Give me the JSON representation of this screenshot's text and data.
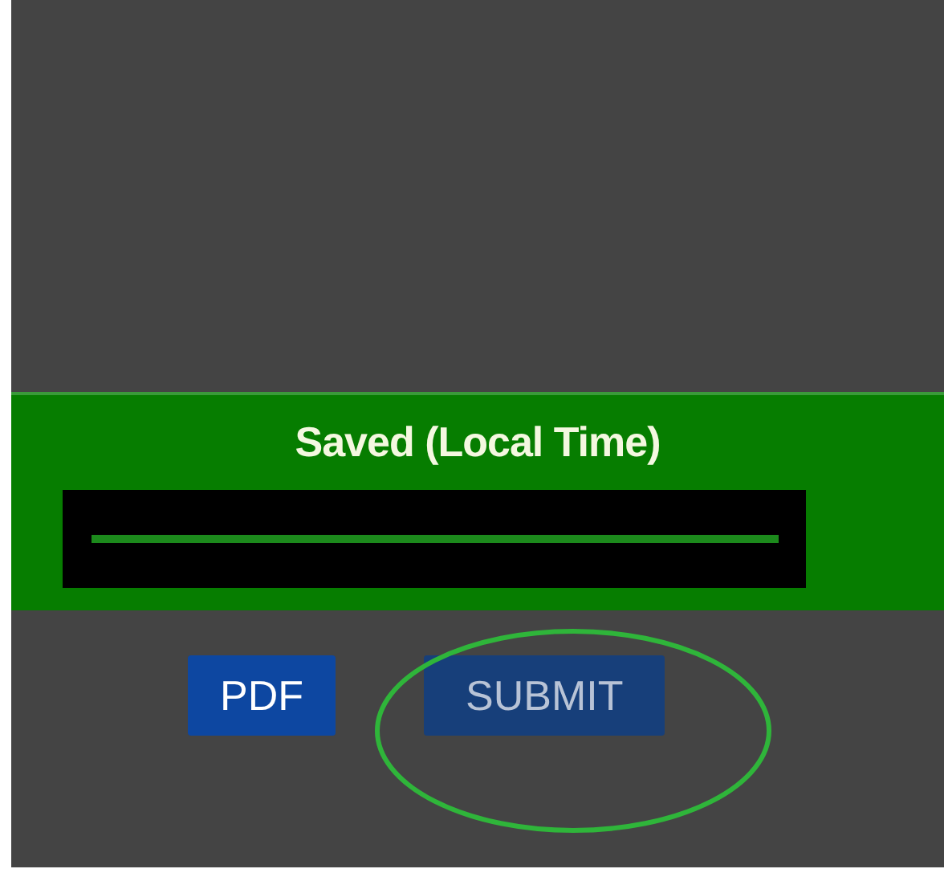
{
  "banner": {
    "title": "Saved (Local Time)",
    "redacted": true
  },
  "buttons": [
    {
      "label": "PDF",
      "disabled": false,
      "circled": false
    },
    {
      "label": "SUBMIT",
      "disabled": true,
      "circled": true
    }
  ]
}
